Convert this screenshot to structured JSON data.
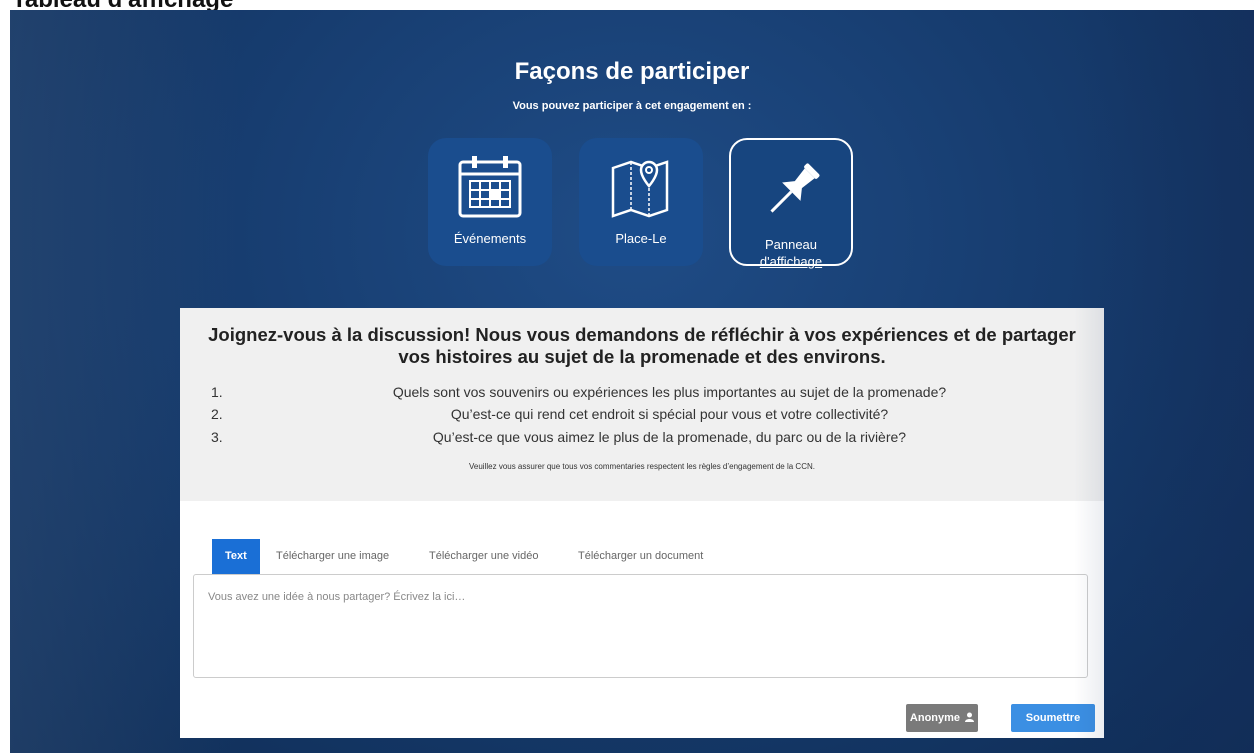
{
  "page_title": "Tableau d'affichage",
  "ways": {
    "title": "Façons de participer",
    "subtitle": "Vous pouvez participer à cet engagement en :",
    "tiles": [
      {
        "label": "Événements",
        "icon": "calendar-icon"
      },
      {
        "label": "Place-Le",
        "icon": "map-pin-icon"
      },
      {
        "label_line1": "Panneau",
        "label_line2": "d'affichage",
        "icon": "pushpin-icon"
      }
    ]
  },
  "discussion": {
    "headline": "Joignez-vous à la discussion! Nous vous demandons de réfléchir à vos expériences et de partager vos histoires au sujet de la promenade et des environs.",
    "questions": [
      {
        "num": "1.",
        "text": "Quels sont vos souvenirs ou expériences les plus importantes au sujet de la promenade?"
      },
      {
        "num": "2.",
        "text": "Qu’est-ce qui rend cet endroit si spécial pour vous et votre collectivité?"
      },
      {
        "num": "3.",
        "text": "Qu’est-ce que vous aimez le plus de la promenade, du parc ou de la rivière?"
      }
    ],
    "note": "Veuillez vous assurer que tous vos commentaries respectent les règles d’engagement de la CCN."
  },
  "composer": {
    "tabs": [
      "Text",
      "Télécharger une image",
      "Télécharger une vidéo",
      "Télécharger un document"
    ],
    "active_tab": "Text",
    "placeholder": "Vous avez une idée à nous partager? Écrivez la ici…",
    "anon_label": "Anonyme",
    "submit_label": "Soumettre"
  },
  "colors": {
    "hero": "#173d70",
    "tile": "#1a4d8e",
    "tab_active": "#1a6fd6",
    "submit": "#3b8fe3",
    "anon": "#7a7a7a"
  }
}
